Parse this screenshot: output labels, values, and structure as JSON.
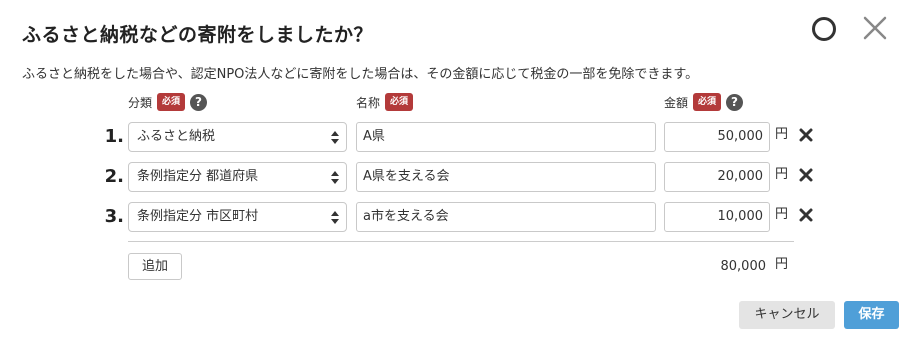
{
  "dialog": {
    "title": "ふるさと納税などの寄附をしましたか？",
    "description": "ふるさと納税をした場合や、認定NPO法人などに寄附をした場合は、その金額に応じて税金の一部を免除できます。"
  },
  "headers": {
    "category": "分類",
    "name": "名称",
    "amount": "金額",
    "required": "必須",
    "help": "?"
  },
  "rows": [
    {
      "num": "1.",
      "category": "ふるさと納税",
      "name": "A県",
      "amount": "50,000",
      "unit": "円"
    },
    {
      "num": "2.",
      "category": "条例指定分 都道府県",
      "name": "A県を支える会",
      "amount": "20,000",
      "unit": "円"
    },
    {
      "num": "3.",
      "category": "条例指定分 市区町村",
      "name": "a市を支える会",
      "amount": "10,000",
      "unit": "円"
    }
  ],
  "footer": {
    "add_label": "追加",
    "total": "80,000",
    "total_unit": "円"
  },
  "actions": {
    "cancel_label": "キャンセル",
    "save_label": "保存"
  },
  "colors": {
    "required_badge": "#b33a3a",
    "save_button": "#4f9fd8",
    "cancel_button": "#e4e4e4"
  },
  "icons": {
    "status": "circle-icon",
    "close": "close-icon",
    "remove": "remove-x-icon",
    "help": "help-icon",
    "select": "select-arrows-icon"
  }
}
